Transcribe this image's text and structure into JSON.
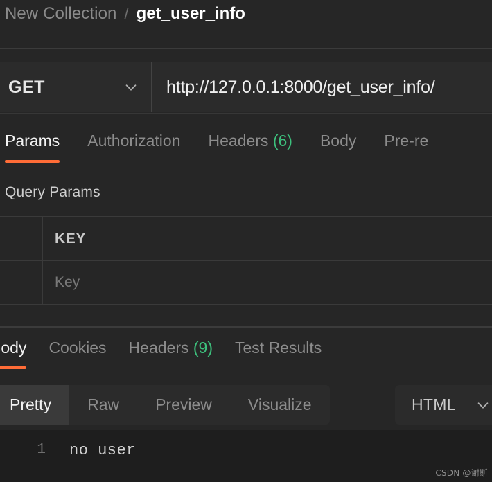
{
  "colors": {
    "accent": "#ff6c37",
    "count_green": "#3dc17d",
    "app_bg": "#262626",
    "field_bg": "#2b2b2b",
    "code_bg": "#1e1e1e"
  },
  "breadcrumb": {
    "collection": "New Collection",
    "separator": "/",
    "current": "get_user_info"
  },
  "url_bar": {
    "method": "GET",
    "method_chevron_icon": "chevron-down-icon",
    "url": "http://127.0.0.1:8000/get_user_info/"
  },
  "request_tabs": [
    {
      "label": "Params",
      "count": "",
      "active": true
    },
    {
      "label": "Authorization",
      "count": "",
      "active": false
    },
    {
      "label": "Headers",
      "count": "(6)",
      "active": false
    },
    {
      "label": "Body",
      "count": "",
      "active": false
    },
    {
      "label": "Pre-re",
      "count": "",
      "active": false
    }
  ],
  "query_params": {
    "title": "Query Params",
    "columns": [
      "KEY"
    ],
    "rows": [
      {
        "key_placeholder": "Key"
      }
    ]
  },
  "response_tabs": [
    {
      "label": "Body",
      "count": "",
      "active": true
    },
    {
      "label": "Cookies",
      "count": "",
      "active": false
    },
    {
      "label": "Headers",
      "count": "(9)",
      "active": false
    },
    {
      "label": "Test Results",
      "count": "",
      "active": false
    }
  ],
  "view_modes": [
    {
      "label": "Pretty",
      "active": true
    },
    {
      "label": "Raw",
      "active": false
    },
    {
      "label": "Preview",
      "active": false
    },
    {
      "label": "Visualize",
      "active": false
    }
  ],
  "format_dropdown": {
    "value": "HTML",
    "chevron_icon": "chevron-down-icon"
  },
  "response_body": {
    "lines": [
      {
        "number": "1",
        "text": "no user"
      }
    ]
  },
  "watermark": "CSDN @谢斯"
}
